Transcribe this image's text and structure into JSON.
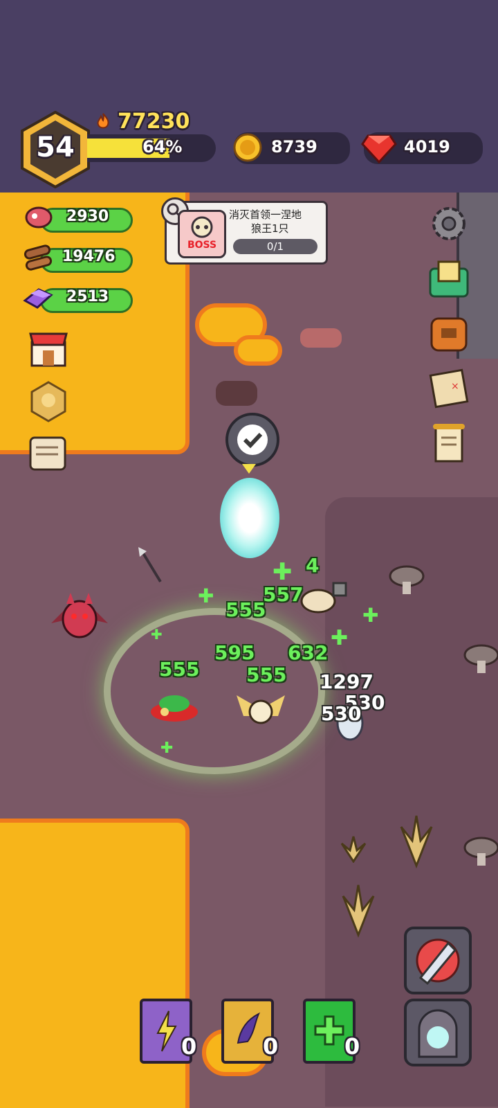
{
  "hud": {
    "level": "54",
    "power": "77230",
    "xp_percent_label": "64%",
    "xp_fraction": 0.64,
    "coins": "8739",
    "gems": "4019"
  },
  "resources": [
    {
      "name": "meat-icon",
      "value": "2930"
    },
    {
      "name": "wood-icon",
      "value": "19476"
    },
    {
      "name": "crystal-icon",
      "value": "2513"
    }
  ],
  "quest": {
    "badge": "BOSS",
    "title_line1": "消灭首领一涅地",
    "title_line2": "狼王1只",
    "progress": "0/1"
  },
  "damage_numbers": [
    "4",
    "557",
    "555",
    "595",
    "632",
    "555",
    "555",
    "1297",
    "530",
    "530"
  ],
  "books": [
    {
      "name": "lightning-book",
      "count": "0"
    },
    {
      "name": "wing-book",
      "count": "0"
    },
    {
      "name": "heal-book",
      "count": "0"
    }
  ],
  "colors": {
    "hud_bg": "#4a3f63",
    "lava": "#f7b51a",
    "heal_green": "#6cf05c",
    "gem_red": "#e8352e"
  }
}
